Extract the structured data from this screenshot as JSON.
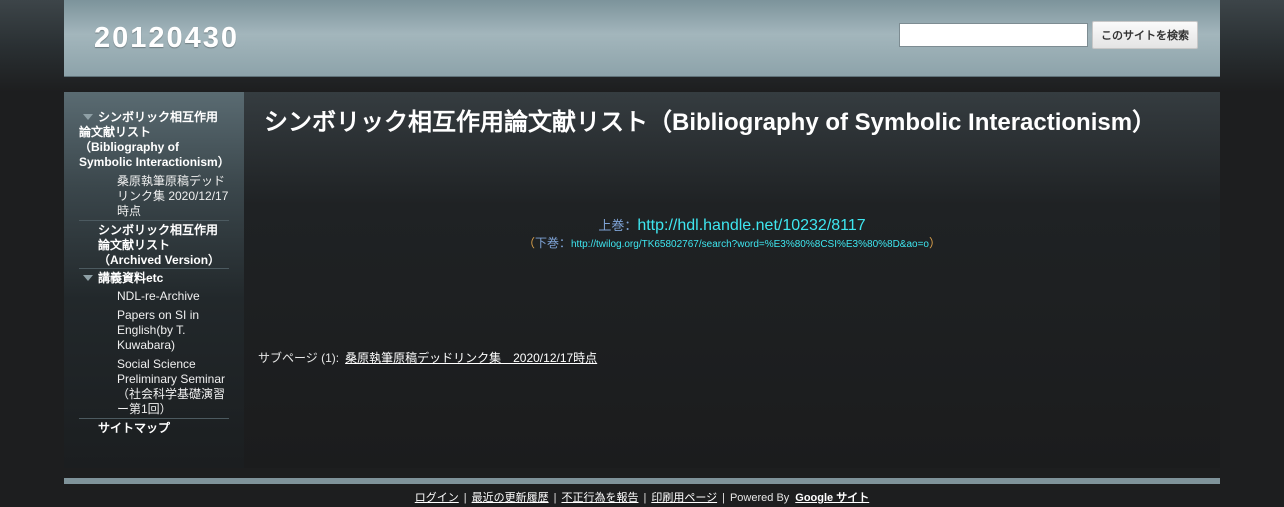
{
  "header": {
    "site_title": "20120430",
    "search_placeholder": "",
    "search_button_label": "このサイトを検索"
  },
  "sidebar": {
    "items": [
      {
        "label": "シンボリック相互作用論文献リスト（Bibliography of Symbolic Interactionism）"
      },
      {
        "label": "桑原執筆原稿デッドリンク集 2020/12/17時点"
      },
      {
        "label": "シンボリック相互作用論文献リスト（Archived Version）"
      },
      {
        "label": "講義資料etc"
      },
      {
        "label": "NDL-re-Archive"
      },
      {
        "label": "Papers on SI in English(by T. Kuwabara)"
      },
      {
        "label": "Social Science Preliminary Seminar（社会科学基礎演習ー第1回）"
      },
      {
        "label": "サイトマップ"
      }
    ]
  },
  "main": {
    "page_title": "シンボリック相互作用論文献リスト（Bibliography of Symbolic Interactionism）",
    "vol1_label": "上巻：",
    "vol1_link": "http://hdl.handle.net/10232/8117",
    "paren_open": "（",
    "vol2_label": "下巻：",
    "vol2_link": "http://twilog.org/TK65802767/search?word=%E3%80%8CSI%E3%80%8D&ao=o",
    "paren_close": "）",
    "subpages_label": "サブページ (1):",
    "subpage_link": "桑原執筆原稿デッドリンク集　2020/12/17時点"
  },
  "footer": {
    "login": "ログイン",
    "recent": "最近の更新履歴",
    "report": "不正行為を報告",
    "print": "印刷用ページ",
    "separator": "|",
    "powered_by": "Powered By",
    "google_sites": "Google サイト"
  }
}
